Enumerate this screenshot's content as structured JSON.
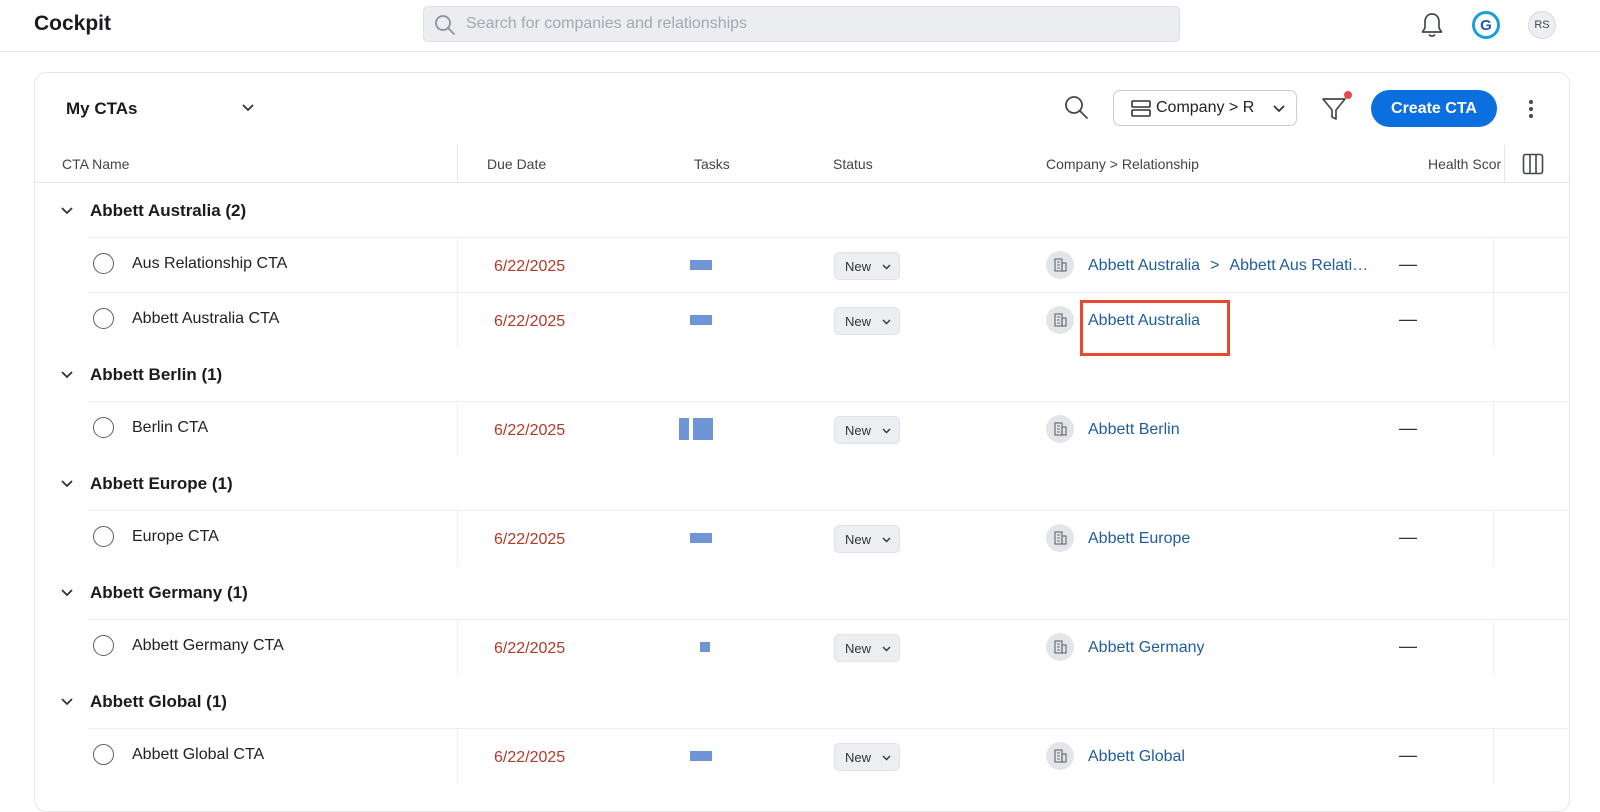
{
  "header": {
    "app_title": "Cockpit",
    "search_placeholder": "Search for companies and relationships",
    "brand_initial": "G",
    "user_initials": "RS"
  },
  "toolbar": {
    "view_label": "My CTAs",
    "group_by_label": "Company > R",
    "create_label": "Create CTA"
  },
  "columns": [
    "CTA Name",
    "Due Date",
    "Tasks",
    "Status",
    "Company > Relationship",
    "Health Scor"
  ],
  "groups": [
    {
      "label": "Abbett Australia (2)",
      "rows": [
        {
          "name": "Aus Relationship CTA",
          "due": "6/22/2025",
          "status": "New",
          "company": "Abbett Australia",
          "relationship": "Abbett Aus Relati…",
          "health": "—"
        },
        {
          "name": "Abbett Australia CTA",
          "due": "6/22/2025",
          "status": "New",
          "company": "Abbett Australia",
          "relationship": "",
          "health": "—"
        }
      ]
    },
    {
      "label": "Abbett Berlin (1)",
      "rows": [
        {
          "name": "Berlin CTA",
          "due": "6/22/2025",
          "status": "New",
          "company": "Abbett Berlin",
          "relationship": "",
          "health": "—"
        }
      ]
    },
    {
      "label": "Abbett Europe (1)",
      "rows": [
        {
          "name": "Europe CTA",
          "due": "6/22/2025",
          "status": "New",
          "company": "Abbett Europe",
          "relationship": "",
          "health": "—"
        }
      ]
    },
    {
      "label": "Abbett Germany (1)",
      "rows": [
        {
          "name": "Abbett Germany CTA",
          "due": "6/22/2025",
          "status": "New",
          "company": "Abbett Germany",
          "relationship": "",
          "health": "—"
        }
      ]
    },
    {
      "label": "Abbett Global (1)",
      "rows": [
        {
          "name": "Abbett Global CTA",
          "due": "6/22/2025",
          "status": "New",
          "company": "Abbett Global",
          "relationship": "",
          "health": "—"
        }
      ]
    }
  ],
  "colors": {
    "primary": "#0c6fe0",
    "due_date": "#b23a27",
    "link": "#1f5e9c",
    "highlight": "#e54a2c",
    "filter_dot": "#e5484d"
  },
  "icons": [
    "search-icon",
    "bell-icon",
    "chevron-down-icon",
    "group-by-icon",
    "filter-icon",
    "kebab-menu-icon",
    "column-picker-icon",
    "company-building-icon"
  ]
}
